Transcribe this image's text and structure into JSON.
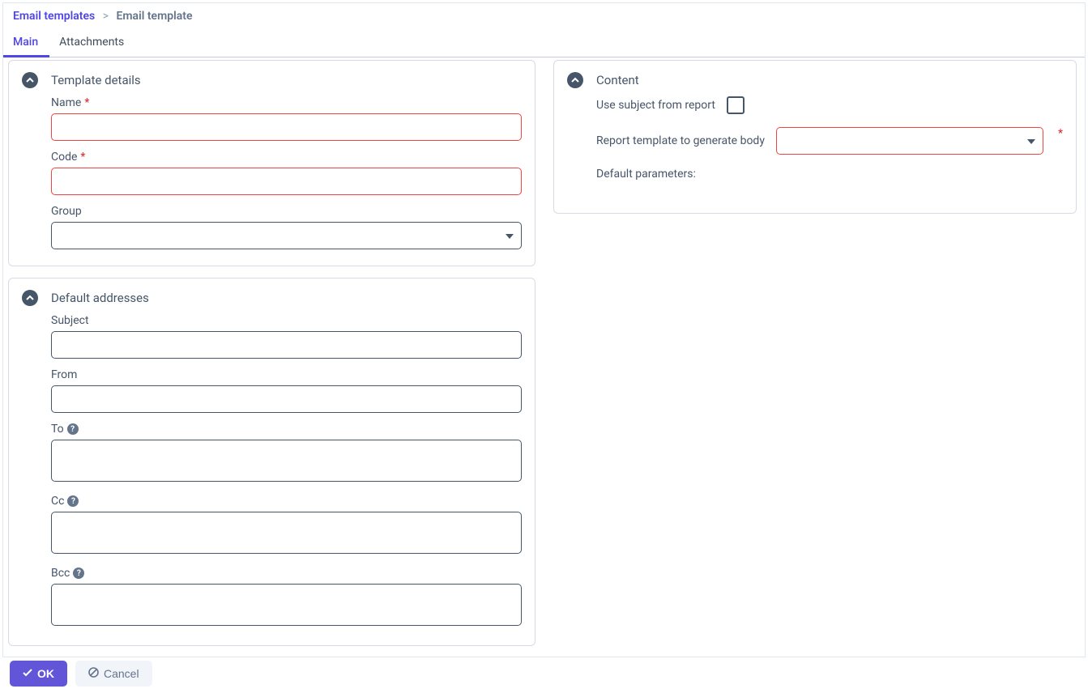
{
  "breadcrumb": {
    "parent": "Email templates",
    "separator": ">",
    "current": "Email template"
  },
  "tabs": {
    "main": "Main",
    "attachments": "Attachments"
  },
  "panels": {
    "template_details": {
      "title": "Template details",
      "name_label": "Name",
      "name_value": "",
      "code_label": "Code",
      "code_value": "",
      "group_label": "Group",
      "group_value": ""
    },
    "default_addresses": {
      "title": "Default addresses",
      "subject_label": "Subject",
      "subject_value": "",
      "from_label": "From",
      "from_value": "",
      "to_label": "To",
      "to_value": "",
      "cc_label": "Cc",
      "cc_value": "",
      "bcc_label": "Bcc",
      "bcc_value": ""
    },
    "content": {
      "title": "Content",
      "use_subject_label": "Use subject from report",
      "use_subject_checked": false,
      "report_template_label": "Report template to generate body",
      "report_template_value": "",
      "default_params_label": "Default parameters:"
    }
  },
  "footer": {
    "ok_label": "OK",
    "cancel_label": "Cancel"
  }
}
